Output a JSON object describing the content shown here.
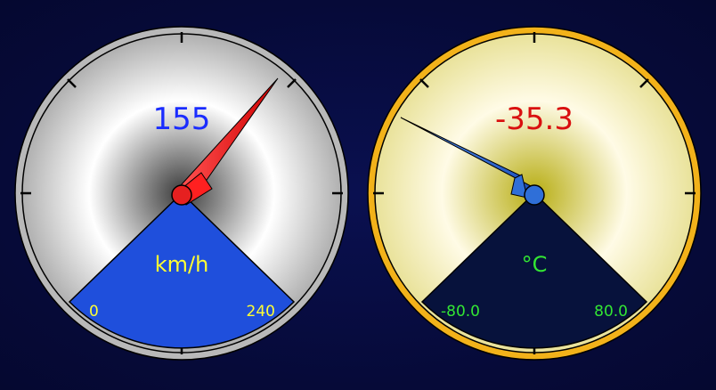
{
  "gauges": [
    {
      "id": "speed",
      "value_text": "155",
      "unit": "km/h",
      "min_label": "0",
      "max_label": "240",
      "min": 0,
      "max": 240,
      "value": 155,
      "colors": {
        "rim": "#b9b9b9",
        "dial_center": "#3a3a3a",
        "dial_ring": "#ffffff",
        "dial_edge": "#b0b0b0",
        "sector": "#1f4fdc",
        "needle": "#ff1a1a",
        "value_text": "#1a2cff",
        "unit_text": "#ffff33",
        "range_text": "#ffff33"
      }
    },
    {
      "id": "temperature",
      "value_text": "-35.3",
      "unit": "°C",
      "min_label": "-80.0",
      "max_label": "80.0",
      "min": -80,
      "max": 80,
      "value": -35.3,
      "colors": {
        "rim": "#f2b21a",
        "dial_center": "#b7ad12",
        "dial_ring": "#fffbe6",
        "dial_edge": "#e9e29a",
        "sector": "#07123c",
        "needle": "#2f6fd8",
        "value_text": "#d90f0f",
        "unit_text": "#33e633",
        "range_text": "#33e633"
      }
    }
  ]
}
